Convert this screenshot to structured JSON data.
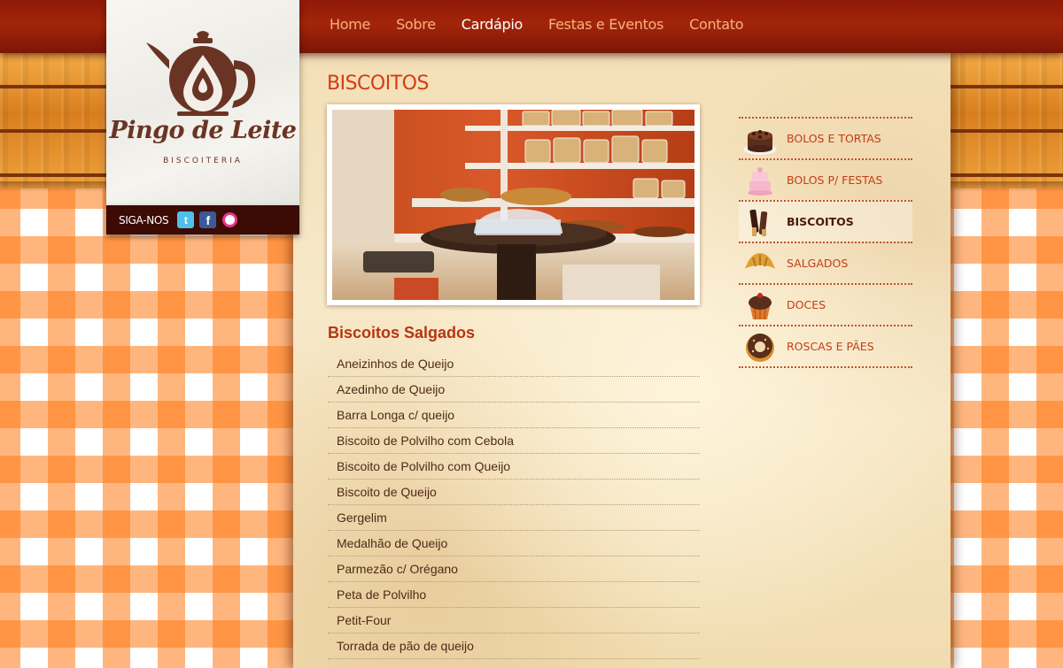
{
  "nav": {
    "items": [
      "Home",
      "Sobre",
      "Cardápio",
      "Festas e Eventos",
      "Contato"
    ],
    "active": "Cardápio"
  },
  "logo": {
    "name": "Pingo de Leite",
    "subtitle": "BISCOITERIA"
  },
  "social": {
    "label": "SIGA-NOS",
    "icons": [
      "twitter-icon",
      "facebook-icon",
      "orkut-icon"
    ]
  },
  "page": {
    "title": "BISCOITOS",
    "section_title": "Biscoitos Salgados",
    "items": [
      "Aneizinhos de Queijo",
      "Azedinho de Queijo",
      "Barra Longa c/ queijo",
      "Biscoito de Polvilho com Cebola",
      "Biscoito de Polvilho com Queijo",
      "Biscoito de Queijo",
      "Gergelim",
      "Medalhão de Queijo",
      "Parmezão c/ Orégano",
      "Peta de Polvilho",
      "Petit-Four",
      "Torrada de pão de queijo"
    ]
  },
  "sidebar": {
    "items": [
      {
        "label": "BOLOS E TORTAS",
        "icon": "chocolate-cake-icon"
      },
      {
        "label": "BOLOS P/ FESTAS",
        "icon": "party-cake-icon"
      },
      {
        "label": "BISCOITOS",
        "icon": "cookie-sticks-icon"
      },
      {
        "label": "SALGADOS",
        "icon": "croissant-icon"
      },
      {
        "label": "DOCES",
        "icon": "cupcake-icon"
      },
      {
        "label": "ROSCAS E PÃES",
        "icon": "donut-icon"
      }
    ],
    "active": "BISCOITOS"
  },
  "colors": {
    "accent_red": "#d63b12",
    "nav_bar": "#8f1a06",
    "gingham_orange": "#ff7a14",
    "text_brown": "#4e2a18"
  }
}
